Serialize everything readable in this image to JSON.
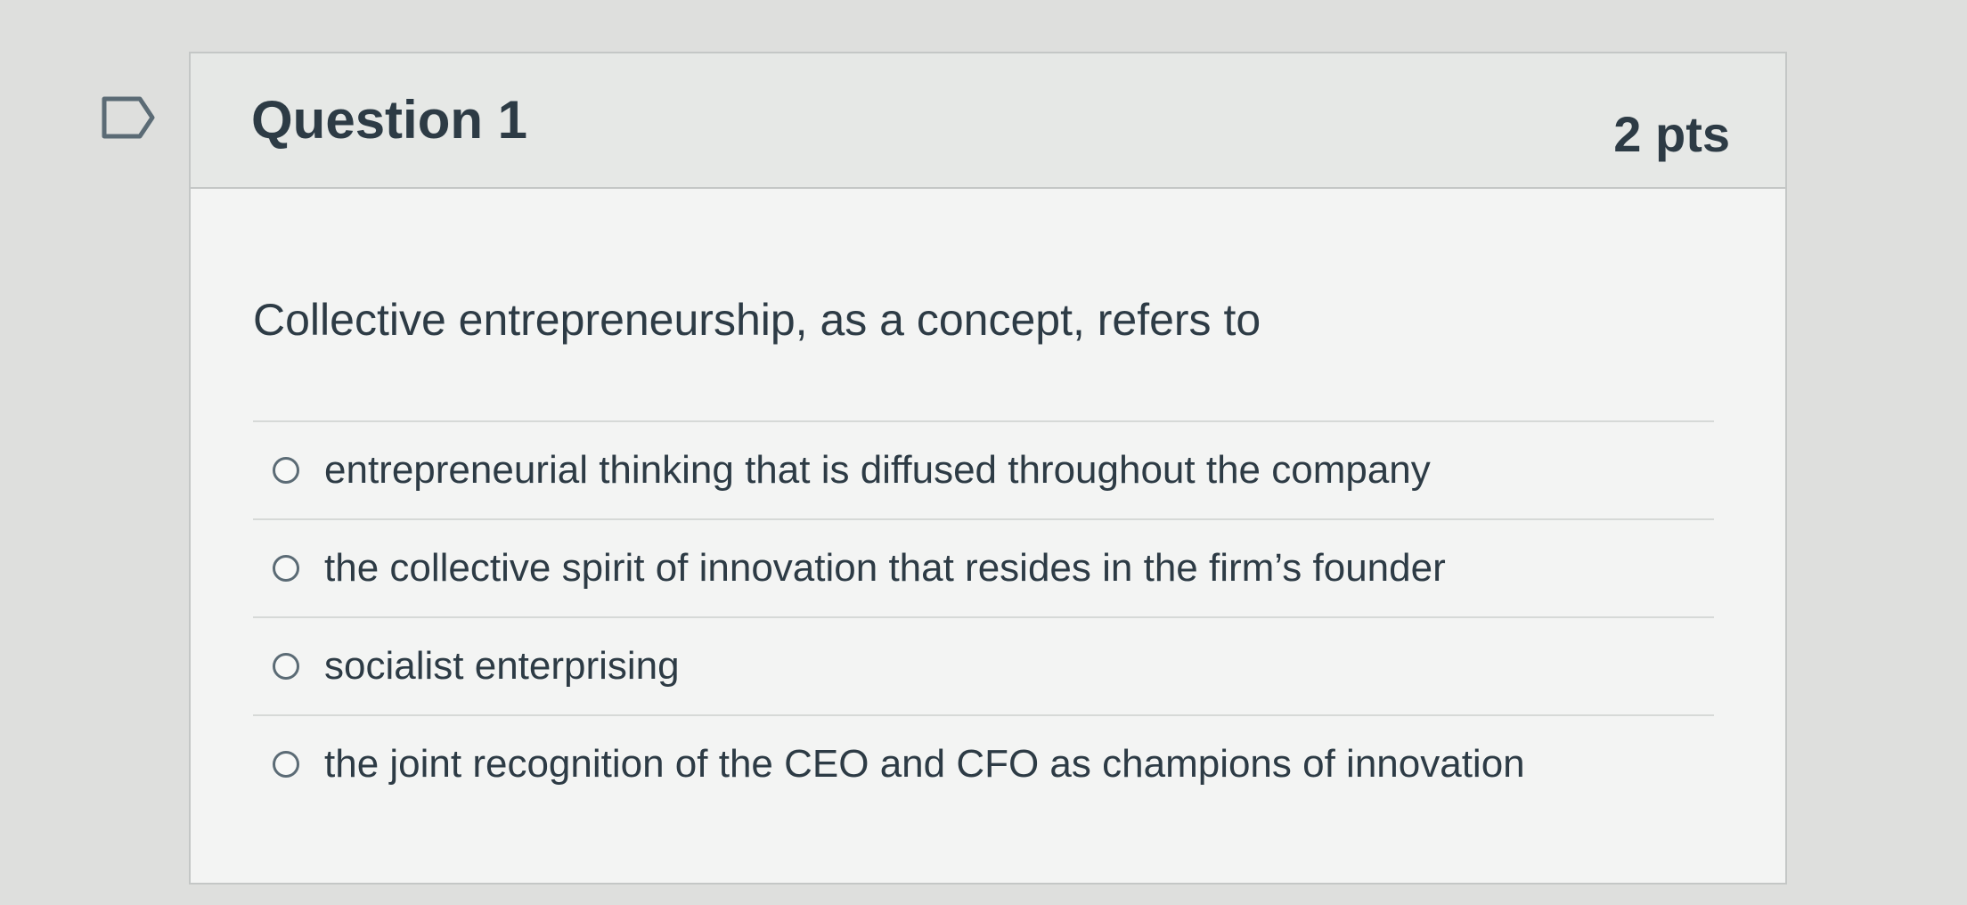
{
  "question": {
    "title": "Question 1",
    "points": "2 pts",
    "text": "Collective entrepreneurship, as a concept, refers to",
    "answers": [
      {
        "label": "entrepreneurial thinking that is diffused throughout the company"
      },
      {
        "label": "the collective spirit of innovation that resides in the firm’s founder"
      },
      {
        "label": "socialist enterprising"
      },
      {
        "label": "the joint recognition of the CEO and CFO as champions of innovation"
      }
    ]
  },
  "icons": {
    "flag": "flag-outline-icon",
    "radio": "radio-unselected-icon"
  },
  "colors": {
    "text": "#2d3b45",
    "border": "#c4c7c6",
    "header_bg": "#e6e8e6"
  }
}
